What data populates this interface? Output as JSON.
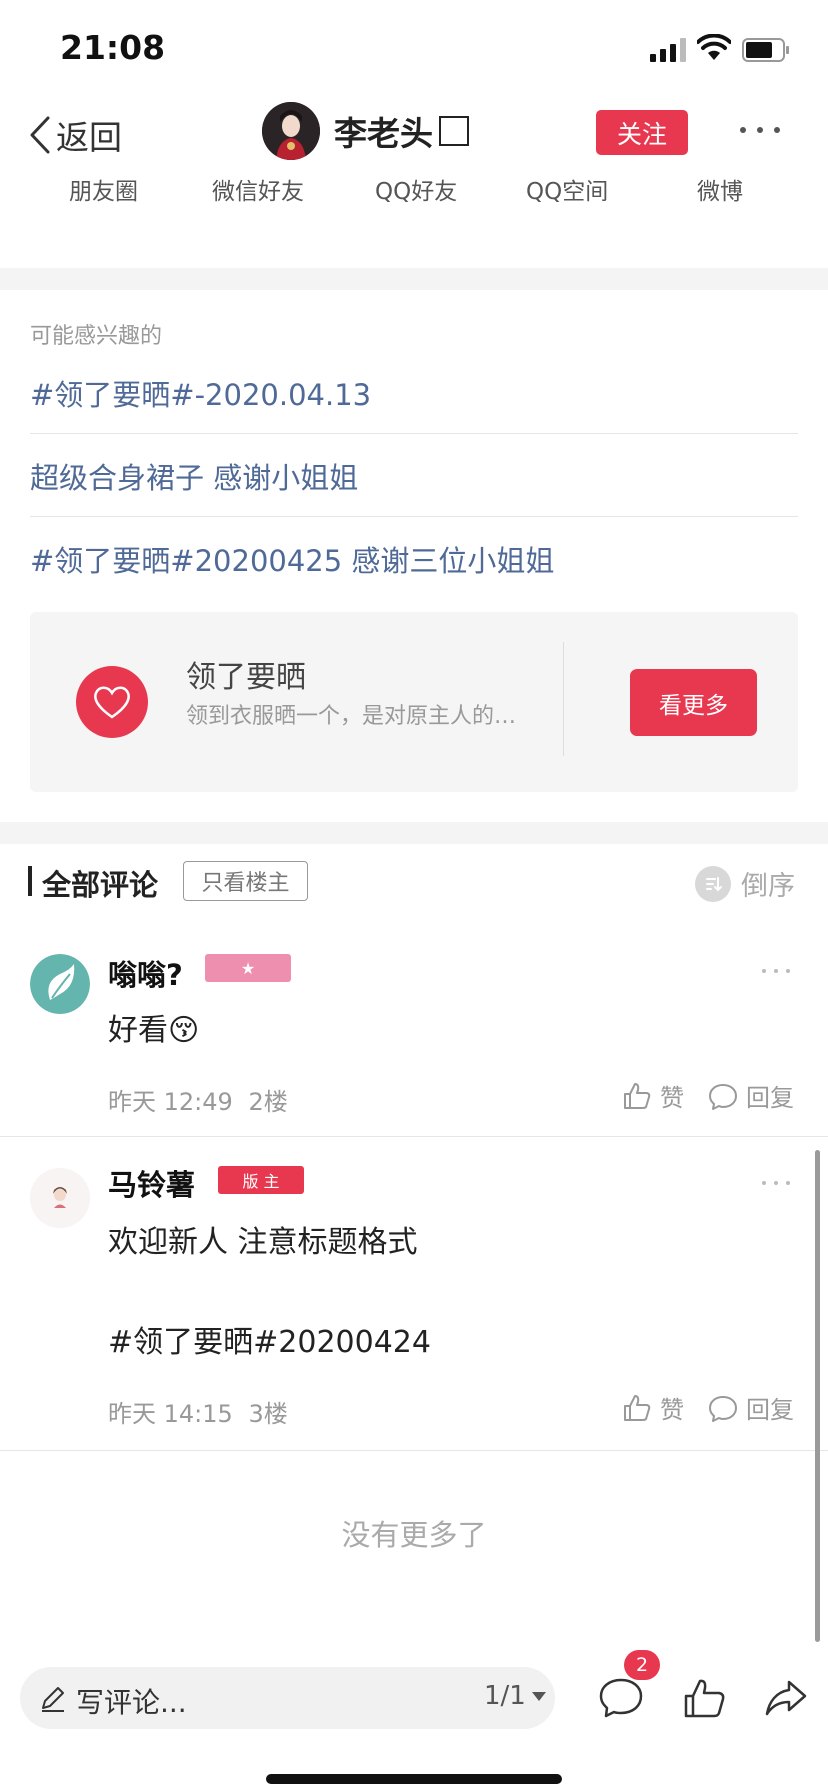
{
  "status_bar": {
    "time": "21:08"
  },
  "header": {
    "back_label": "返回",
    "author_name": "李老头",
    "follow_label": "关注"
  },
  "share": {
    "items": [
      "朋友圈",
      "微信好友",
      "QQ好友",
      "QQ空间",
      "微博"
    ]
  },
  "recommend": {
    "title": "可能感兴趣的",
    "links": [
      "#领了要晒#-2020.04.13",
      "超级合身裙子 感谢小姐姐",
      "#领了要晒#20200425 感谢三位小姐姐"
    ]
  },
  "topic": {
    "name": "领了要晒",
    "desc": "领到衣服晒一个，是对原主人的尊重",
    "button": "看更多",
    "color": "#e8384f"
  },
  "comments_header": {
    "title": "全部评论",
    "only_host": "只看楼主",
    "sort": "倒序"
  },
  "comments": [
    {
      "name": "嗡嗡?",
      "badge": "★",
      "badge_color": "#ef8fb0",
      "text": "好看😚",
      "time": "昨天 12:49",
      "floor": "2楼",
      "like": "赞",
      "reply": "回复"
    },
    {
      "name": "马铃薯",
      "badge": "版 主",
      "badge_color": "#e8384f",
      "text_line1": "欢迎新人 注意标题格式",
      "text_line2": "#领了要晒#20200424",
      "time": "昨天 14:15",
      "floor": "3楼",
      "like": "赞",
      "reply": "回复"
    }
  ],
  "no_more": "没有更多了",
  "bottom": {
    "write_placeholder": "写评论...",
    "page": "1/1",
    "comment_count": "2"
  }
}
